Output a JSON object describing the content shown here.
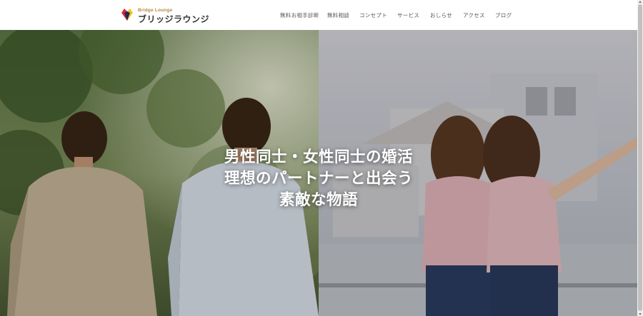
{
  "brand": {
    "small": "Bridge Lounge",
    "name": "ブリッジラウンジ",
    "logo_icon": "heart-diamond-icon",
    "colors": {
      "red": "#d9283b",
      "yellow": "#f2c230",
      "navy": "#1f2a52",
      "gold": "#b5893c"
    }
  },
  "nav": {
    "items": [
      {
        "label": "無料お相手診断"
      },
      {
        "label": "無料相談"
      },
      {
        "label": "コンセプト"
      },
      {
        "label": "サービス"
      },
      {
        "label": "おしらせ"
      },
      {
        "label": "アクセス"
      },
      {
        "label": "ブログ"
      }
    ]
  },
  "hero": {
    "lines": [
      "男性同士・女性同士の婚活",
      "理想のパートナーと出会う",
      "素敵な物語"
    ]
  }
}
